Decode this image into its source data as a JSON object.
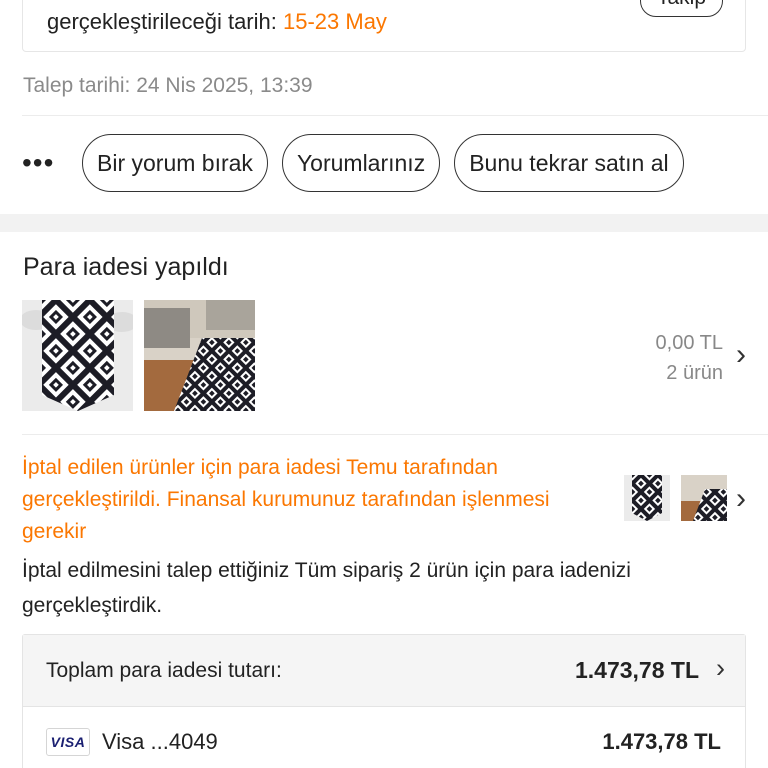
{
  "shipment": {
    "date_label": "gerçekleştirileceği tarih: ",
    "date_range": "15-23 May",
    "follow_label": "Takip"
  },
  "order": {
    "request_date": "Talep tarihi: 24 Nis 2025, 13:39"
  },
  "actions": {
    "more_label": "•••",
    "buttons": [
      {
        "label": "Bir yorum bırak"
      },
      {
        "label": "Yorumlarınız"
      },
      {
        "label": "Bunu tekrar satın al"
      }
    ]
  },
  "refund": {
    "title": "Para iadesi yapıldı",
    "amount": "0,00 TL",
    "item_count": "2 ürün",
    "notice": "İptal edilen ürünler için para iadesi Temu tarafından gerçekleştirildi. Finansal kurumunuz tarafından işlenmesi gerekir",
    "explanation": "İptal edilmesini talep ettiğiniz Tüm sipariş 2 ürün için para iadenizi gerçekleştirdik.",
    "total_label": "Toplam para iadesi tutarı:",
    "total_value": "1.473,78 TL",
    "payment": {
      "brand": "VISA",
      "card": "Visa ...4049",
      "amount": "1.473,78 TL"
    }
  },
  "colors": {
    "accent": "#fb7701",
    "visa": "#1a1f71"
  },
  "icons": {
    "chevron": "chevron-right-icon",
    "more": "more-horizontal-icon"
  }
}
